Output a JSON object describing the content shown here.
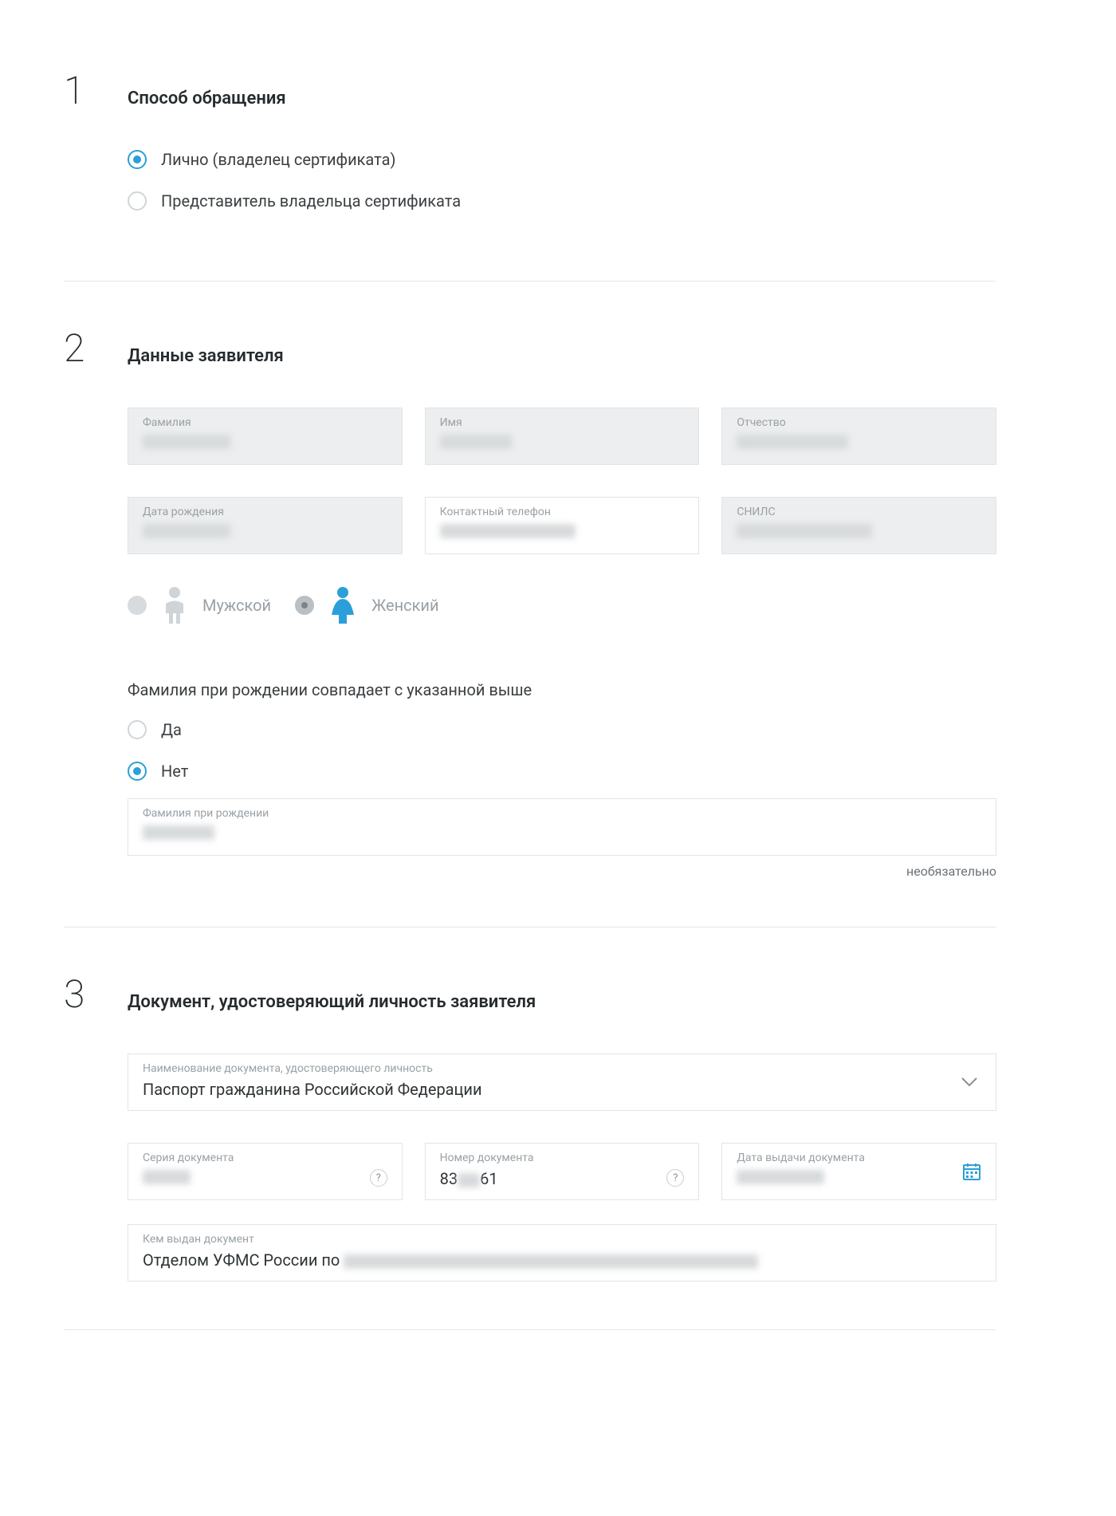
{
  "step1": {
    "title": "Способ обращения",
    "options": {
      "personal": "Лично (владелец сертификата)",
      "representative": "Представитель владельца сертификата"
    }
  },
  "step2": {
    "title": "Данные заявителя",
    "labels": {
      "surname": "Фамилия",
      "name": "Имя",
      "patronymic": "Отчество",
      "dob": "Дата рождения",
      "phone": "Контактный телефон",
      "snils": "СНИЛС"
    },
    "gender": {
      "male": "Мужской",
      "female": "Женский"
    },
    "birth_surname_question": "Фамилия при рождении совпадает с указанной выше",
    "yesno": {
      "yes": "Да",
      "no": "Нет"
    },
    "birth_surname_label": "Фамилия при рождении",
    "optional_note": "необязательно"
  },
  "step3": {
    "title": "Документ, удостоверяющий личность заявителя",
    "labels": {
      "doc_name": "Наименование документа, удостоверяющего личность",
      "series": "Серия документа",
      "number": "Номер документа",
      "issue_date": "Дата выдачи документа",
      "issued_by": "Кем выдан документ"
    },
    "values": {
      "doc_name": "Паспорт гражданина Российской Федерации",
      "number_prefix": "83",
      "number_suffix": "61",
      "issued_by_prefix": "Отделом УФМС России по"
    }
  }
}
